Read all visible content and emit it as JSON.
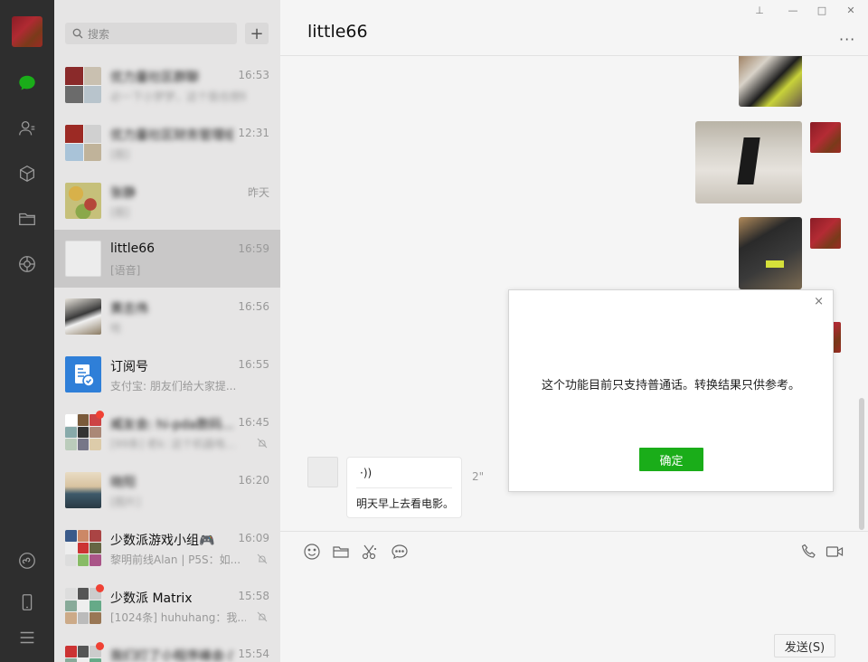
{
  "search": {
    "placeholder": "搜索"
  },
  "add_label": "+",
  "chats": [
    {
      "name": "优力量社区群聊",
      "time": "16:53",
      "message": "必一下小梦梦，这个我也想知道的脸",
      "blurred": true
    },
    {
      "name": "优力量社区财务管理组",
      "time": "12:31",
      "message": "[图]",
      "blurred": true
    },
    {
      "name": "张静",
      "time": "昨天",
      "message": "[图]",
      "blurred": true
    },
    {
      "name": "little66",
      "time": "16:59",
      "message": "[语音]",
      "blurred": false,
      "active": true
    },
    {
      "name": "黄志伟",
      "time": "16:56",
      "message": "哈",
      "blurred": true
    },
    {
      "name": "订阅号",
      "time": "16:55",
      "message": "支付宝: 朋友们给大家提...",
      "blurred": false
    },
    {
      "name": "威友会: hi-pda数码...",
      "time": "16:45",
      "message": "[99条] 老k: 这个机器电...",
      "blurred": true
    },
    {
      "name": "晓阳",
      "time": "16:20",
      "message": "[图片]",
      "blurred": true
    },
    {
      "name": "少数派游戏小组🎮",
      "time": "16:09",
      "message": "黎明前线Alan | P5S：如...",
      "blurred": false
    },
    {
      "name": "少数派 Matrix",
      "time": "15:58",
      "message": "[1024条] huhuhang：我...",
      "blurred": false
    },
    {
      "name": "我们打了小程序峰会·广...",
      "time": "15:54",
      "message": "",
      "blurred": true
    }
  ],
  "chat": {
    "title": "little66",
    "more": "···",
    "voice_duration": "2\"",
    "voice_text": "明天早上去看电影。",
    "voice_symbol": "·))"
  },
  "window": {
    "pin": "⊥",
    "minimize": "—",
    "maximize": "□",
    "close": "✕"
  },
  "toolbar": {
    "send_label": "发送(S)"
  },
  "dialog": {
    "message": "这个功能目前只支持普通话。转换结果只供参考。",
    "ok_label": "确定",
    "close": "×"
  },
  "colors": {
    "accent": "#1aad19",
    "nav_bg": "#2e2e2e",
    "list_bg": "#e6e5e5",
    "badge": "#f04134"
  }
}
